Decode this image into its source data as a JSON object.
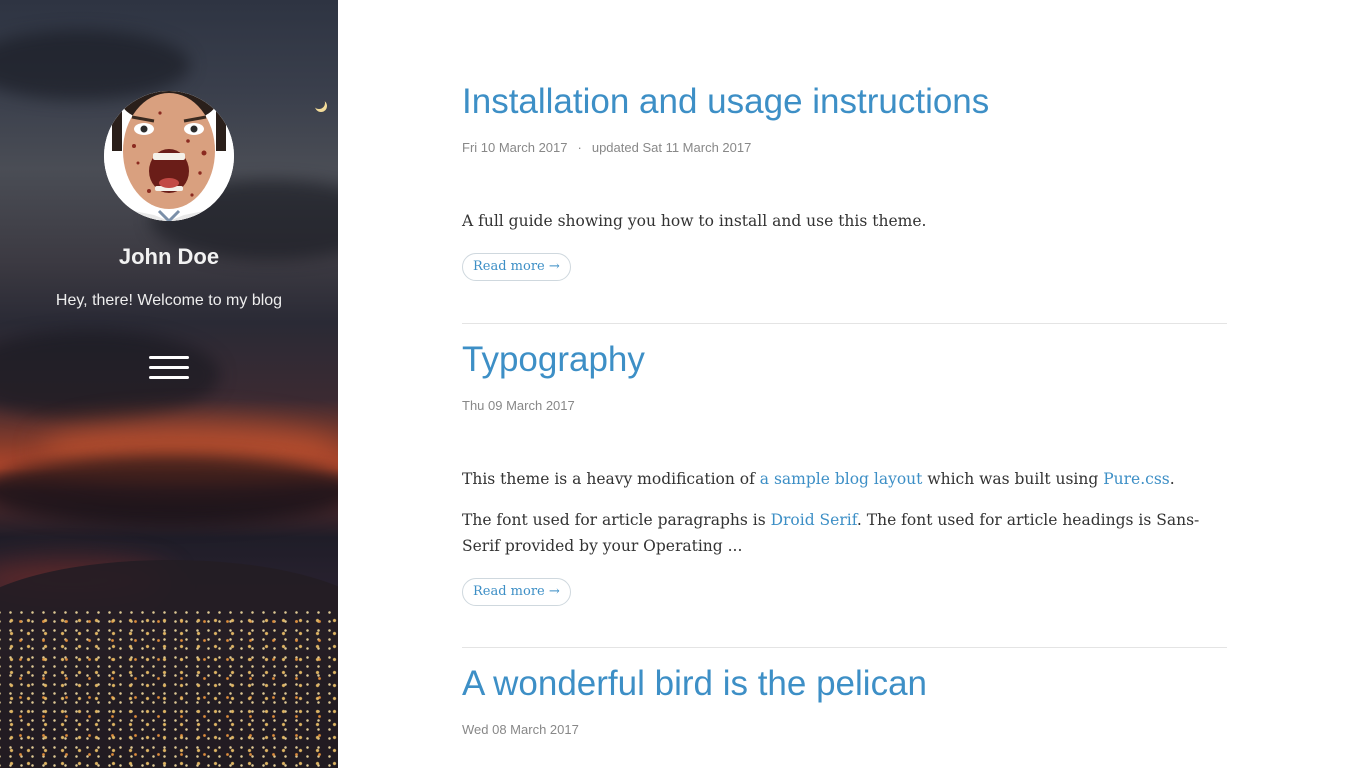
{
  "sidebar": {
    "author_name": "John Doe",
    "tagline": "Hey, there! Welcome to my blog",
    "avatar_icon": "avatar-photo",
    "menu_icon": "hamburger-menu-icon"
  },
  "colors": {
    "accent": "#3d8fc6",
    "body_text": "#333333",
    "meta_text": "#888888",
    "divider": "#e4e4e4"
  },
  "posts": [
    {
      "title": "Installation and usage instructions",
      "date": "Fri 10 March 2017",
      "separator": "·",
      "updated": "updated Sat 11 March 2017",
      "summary": "A full guide showing you how to install and use this theme.",
      "read_more": "Read more →"
    },
    {
      "title": "Typography",
      "date": "Thu 09 March 2017",
      "p1_a": "This theme is a heavy modification of ",
      "p1_link1": "a sample blog layout",
      "p1_b": " which was built using ",
      "p1_link2": "Pure.css",
      "p1_c": ".",
      "p2_a": "The font used for article paragraphs is ",
      "p2_link": "Droid Serif",
      "p2_b": ". The font used for article headings is Sans-Serif provided by your Operating ...",
      "read_more": "Read more →"
    },
    {
      "title": "A wonderful bird is the pelican",
      "date": "Wed 08 March 2017"
    }
  ]
}
